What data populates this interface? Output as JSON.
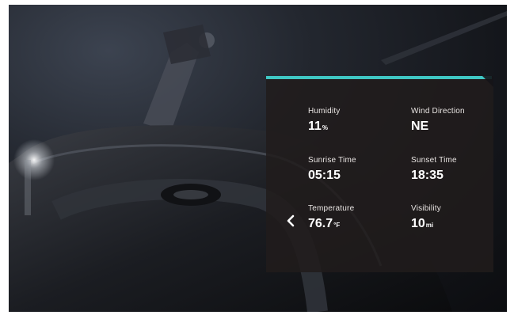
{
  "panel": {
    "accent_color": "#3fc7c4",
    "back_icon": "chevron-left-icon",
    "metrics": {
      "humidity": {
        "label": "Humidity",
        "value": "11",
        "unit": "%"
      },
      "wind_direction": {
        "label": "Wind Direction",
        "value": "NE",
        "unit": ""
      },
      "sunrise_time": {
        "label": "Sunrise Time",
        "value": "05:15",
        "unit": ""
      },
      "sunset_time": {
        "label": "Sunset Time",
        "value": "18:35",
        "unit": ""
      },
      "temperature": {
        "label": "Temperature",
        "value": "76.7",
        "unit": "°F"
      },
      "visibility": {
        "label": "Visibility",
        "value": "10",
        "unit": "mi"
      }
    }
  }
}
